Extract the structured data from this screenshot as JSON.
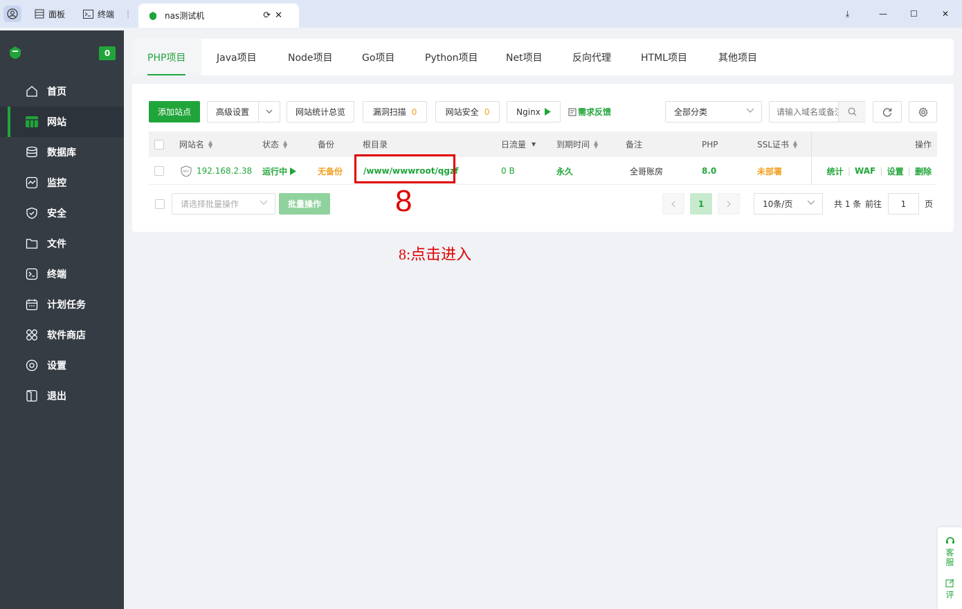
{
  "browser": {
    "tabs": [
      {
        "label": "面板"
      },
      {
        "label": "终端"
      }
    ],
    "active_tab": {
      "label": "nas测试机"
    }
  },
  "sidebar": {
    "badge": "0",
    "items": [
      {
        "label": "首页",
        "icon": "home-icon"
      },
      {
        "label": "网站",
        "icon": "website-icon"
      },
      {
        "label": "数据库",
        "icon": "database-icon"
      },
      {
        "label": "监控",
        "icon": "monitor-icon"
      },
      {
        "label": "安全",
        "icon": "shield-icon"
      },
      {
        "label": "文件",
        "icon": "folder-icon"
      },
      {
        "label": "终端",
        "icon": "terminal-icon"
      },
      {
        "label": "计划任务",
        "icon": "calendar-icon"
      },
      {
        "label": "软件商店",
        "icon": "apps-icon"
      },
      {
        "label": "设置",
        "icon": "gear-icon"
      },
      {
        "label": "退出",
        "icon": "logout-icon"
      }
    ]
  },
  "project_tabs": [
    "PHP项目",
    "Java项目",
    "Node项目",
    "Go项目",
    "Python项目",
    "Net项目",
    "反向代理",
    "HTML项目",
    "其他项目"
  ],
  "toolbar": {
    "add_site": "添加站点",
    "advanced": "高级设置",
    "stats": "网站统计总览",
    "vuln_scan": "漏洞扫描",
    "vuln_count": "0",
    "site_security": "网站安全",
    "security_count": "0",
    "nginx": "Nginx",
    "feedback": "需求反馈",
    "category": "全部分类",
    "search_placeholder": "请输入域名或备注"
  },
  "table": {
    "headers": {
      "name": "网站名",
      "status": "状态",
      "backup": "备份",
      "root": "根目录",
      "traffic": "日流量",
      "expire": "到期时间",
      "remark": "备注",
      "php": "PHP",
      "ssl": "SSL证书",
      "ops": "操作"
    },
    "row": {
      "name": "192.168.2.38",
      "status": "运行中",
      "backup": "无备份",
      "root": "/www/wwwroot/qgzf",
      "traffic": "0 B",
      "expire": "永久",
      "remark": "全哥账房",
      "php": "8.0",
      "ssl": "未部署",
      "op_stats": "统计",
      "op_waf": "WAF",
      "op_settings": "设置",
      "op_delete": "删除"
    }
  },
  "footer": {
    "batch_select": "请选择批量操作",
    "batch_btn": "批量操作",
    "page": "1",
    "page_size": "10条/页",
    "total": "共 1 条",
    "goto": "前往",
    "goto_value": "1",
    "page_suffix": "页"
  },
  "annotation": {
    "number": "8",
    "text": "8:点击进入"
  },
  "float_side": {
    "service": "客服",
    "review": "评"
  }
}
